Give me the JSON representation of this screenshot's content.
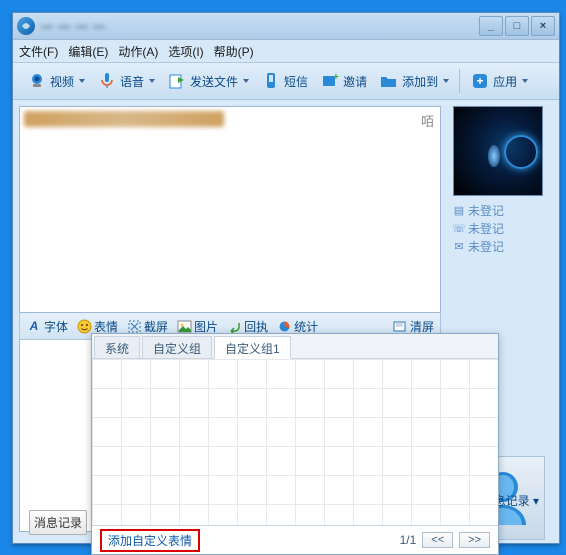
{
  "title_blur": "— — — —",
  "winbtns": {
    "min": "_",
    "max": "□",
    "close": "×"
  },
  "menu": {
    "file": "文件(F)",
    "edit": "编辑(E)",
    "action": "动作(A)",
    "option": "选项(I)",
    "help": "帮助(P)"
  },
  "toolbar": {
    "video": "视频",
    "voice": "语音",
    "sendfile": "发送文件",
    "sms": "短信",
    "invite": "邀请",
    "addto": "添加到",
    "app": "应用"
  },
  "msg_corner": "咟",
  "fmt": {
    "font": "字体",
    "emoji": "表情",
    "screenshot": "截屏",
    "image": "图片",
    "reply": "回执",
    "stats": "统计",
    "clear": "清屏"
  },
  "contact": {
    "l1": "未登记",
    "l2": "未登记",
    "l3": "未登记"
  },
  "history": "消息记录",
  "history_link": "消息记录",
  "emoji_tabs": {
    "sys": "系统",
    "custom_group": "自定义组",
    "custom1": "自定义组1"
  },
  "emoji_add": "添加自定义表情",
  "emoji_page": "1/1",
  "emoji_prev": "<<",
  "emoji_next": ">>"
}
